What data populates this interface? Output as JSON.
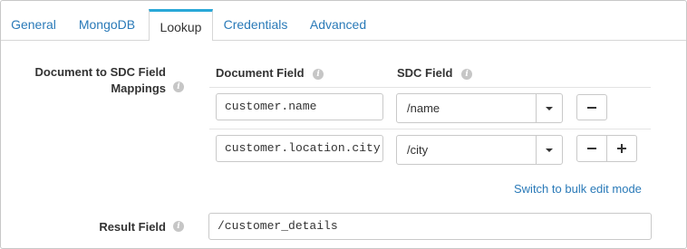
{
  "tabs": [
    {
      "label": "General",
      "active": false
    },
    {
      "label": "MongoDB",
      "active": false
    },
    {
      "label": "Lookup",
      "active": true
    },
    {
      "label": "Credentials",
      "active": false
    },
    {
      "label": "Advanced",
      "active": false
    }
  ],
  "mappings": {
    "label_line1": "Document to SDC Field",
    "label_line2": "Mappings",
    "col_document_field": "Document Field",
    "col_sdc_field": "SDC Field",
    "rows": [
      {
        "document_field": "customer.name",
        "sdc_field": "/name"
      },
      {
        "document_field": "customer.location.city",
        "sdc_field": "/city"
      }
    ],
    "bulk_edit_link": "Switch to bulk edit mode"
  },
  "result_field": {
    "label": "Result Field",
    "value": "/customer_details"
  },
  "colors": {
    "accent": "#2aa8d8",
    "link": "#2a7ab8",
    "info_icon": "#c6c6c6"
  },
  "icons": {
    "info": "info-icon",
    "caret": "caret-down-icon",
    "remove": "minus-icon",
    "add": "plus-icon"
  }
}
